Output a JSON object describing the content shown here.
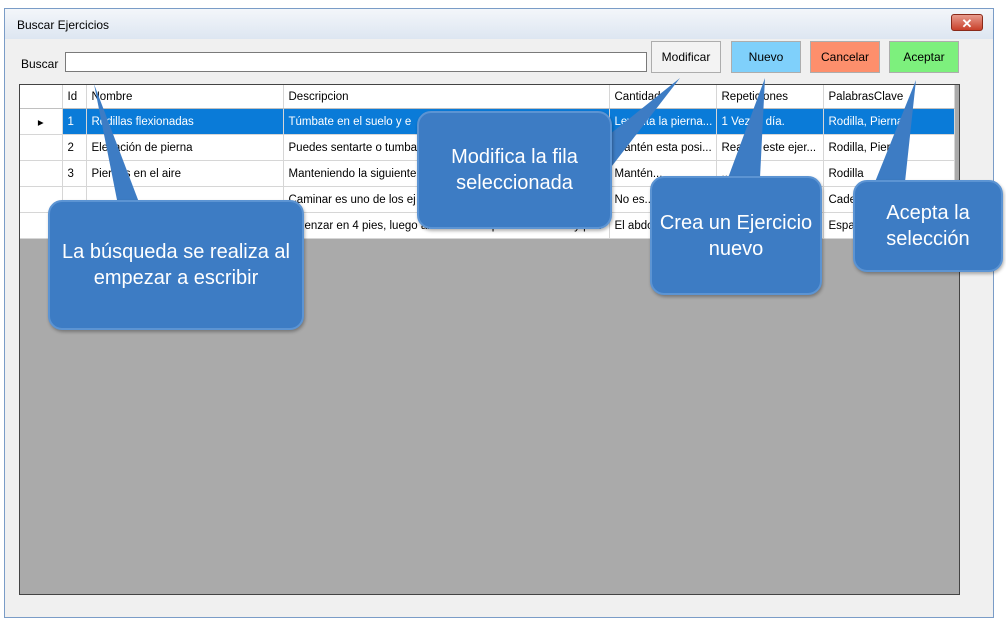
{
  "window": {
    "title": "Buscar Ejercicios",
    "close_glyph": "✕"
  },
  "search": {
    "label": "Buscar",
    "value": ""
  },
  "buttons": {
    "modificar": "Modificar",
    "nuevo": "Nuevo",
    "cancelar": "Cancelar",
    "aceptar": "Aceptar"
  },
  "table": {
    "headers": [
      "Id",
      "Nombre",
      "Descripcion",
      "Cantidad",
      "Repeticiones",
      "PalabrasClave"
    ],
    "rows": [
      {
        "selected": true,
        "cells": [
          "1",
          "Rodillas flexionadas",
          "Túmbate  en el suelo y e",
          "Levanta la pierna...",
          "1 Vez al día.",
          "Rodilla, Pierna"
        ]
      },
      {
        "selected": false,
        "cells": [
          "2",
          "Elevación de pierna",
          "Puedes sentarte o tumba",
          "Mantén esta posi...",
          "Realiza este ejer...",
          "Rodilla, Pierna"
        ]
      },
      {
        "selected": false,
        "cells": [
          "3",
          "Piernas en el aire",
          "Manteniendo la siguiente",
          "Mantén...",
          "...",
          "Rodilla"
        ]
      },
      {
        "selected": false,
        "cells": [
          "",
          "",
          "Caminar es uno de los ej",
          "No es...",
          "...",
          "Cadera"
        ]
      },
      {
        "selected": false,
        "cells": [
          "",
          "",
          "omenzar en 4 pies, luego al mismo tiempo elevar brazo y pi...",
          "El abdo...",
          "...",
          "Espalda"
        ]
      }
    ]
  },
  "callouts": {
    "busqueda": "La búsqueda se realiza al empezar a escribir",
    "modifica": "Modifica la fila seleccionada",
    "crea": "Crea un Ejercicio nuevo",
    "acepta": "Acepta la selección"
  },
  "colors": {
    "selected_row": "#0a7bd8",
    "callout_bg": "#3d7cc4",
    "nuevo": "#7fd0fb",
    "cancelar": "#fd8f6c",
    "aceptar": "#7df07d"
  }
}
